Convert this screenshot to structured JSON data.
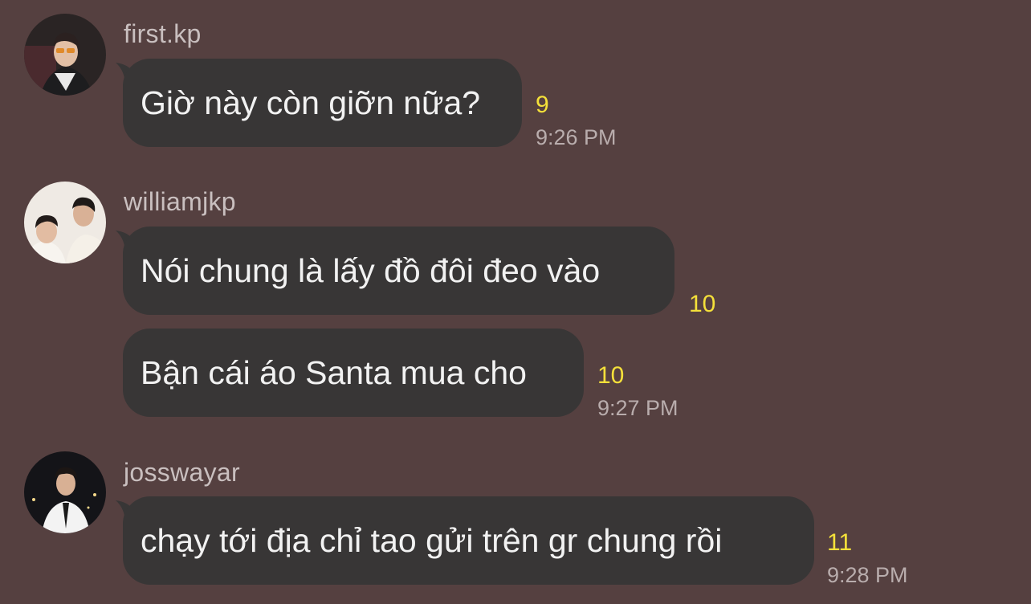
{
  "messages": [
    {
      "username": "first.kp",
      "avatar_icon": "profile-photo-sunglasses-icon",
      "bubbles": [
        {
          "text": "Giờ này còn giỡn nữa?",
          "read_count": "9",
          "time": "9:26 PM"
        }
      ]
    },
    {
      "username": "williamjkp",
      "avatar_icon": "profile-photo-two-people-icon",
      "bubbles": [
        {
          "text": "Nói chung là lấy đồ đôi đeo vào",
          "read_count": "10"
        },
        {
          "text": "Bận cái áo Santa mua cho",
          "read_count": "10",
          "time": "9:27 PM"
        }
      ]
    },
    {
      "username": "josswayar",
      "avatar_icon": "profile-photo-suit-icon",
      "bubbles": [
        {
          "text": "chạy tới địa chỉ tao gửi trên gr chung rồi",
          "read_count": "11",
          "time": "9:28 PM"
        }
      ]
    }
  ],
  "colors": {
    "background": "#554040",
    "bubble": "#383636",
    "read_count": "#f4e03a",
    "time": "#b9adad"
  }
}
